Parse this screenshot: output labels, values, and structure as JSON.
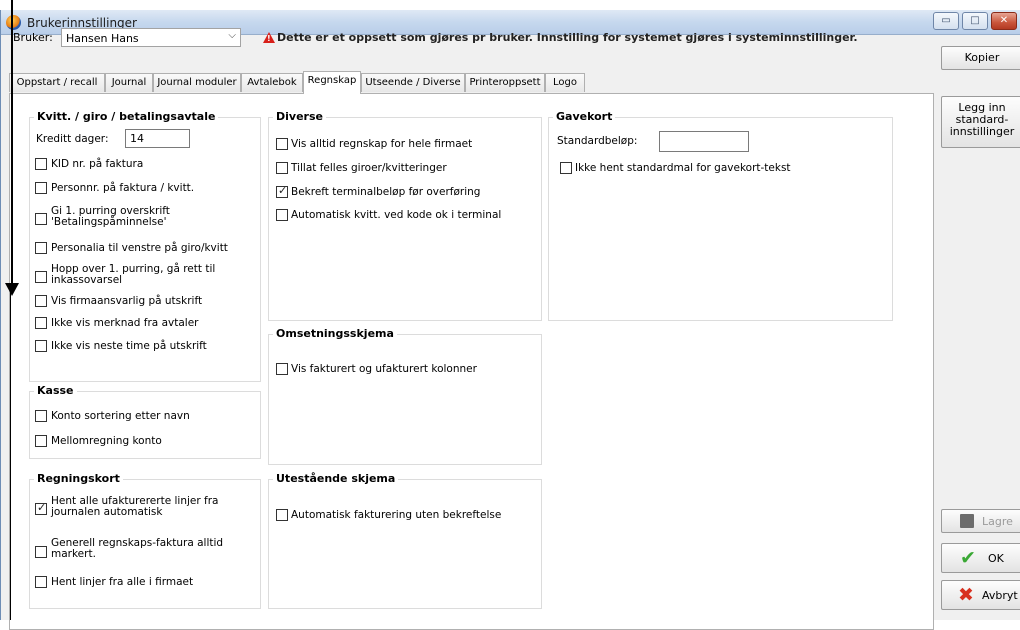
{
  "window": {
    "title": "Brukerinnstillinger",
    "controls": [
      "minimize",
      "maximize",
      "close"
    ]
  },
  "user": {
    "label": "Bruker:",
    "value": "Hansen Hans",
    "warning": "Dette er et oppsett som gjøres pr bruker. Innstilling for systemet gjøres i systeminnstillinger."
  },
  "side_buttons": {
    "copy": "Kopier",
    "standard": "Legg inn standard-innstillinger",
    "save": "Lagre",
    "ok": "OK",
    "cancel": "Avbryt"
  },
  "tabs": [
    "Oppstart / recall",
    "Journal",
    "Journal moduler",
    "Avtalebok",
    "Regnskap",
    "Utseende / Diverse",
    "Printeroppsett",
    "Logo"
  ],
  "active_tab": "Regnskap",
  "kvitt": {
    "title": "Kvitt. / giro / betalingsavtale",
    "kreditt_label": "Kreditt dager:",
    "kreditt_value": "14",
    "items": [
      {
        "label": "KID nr. på faktura",
        "checked": false
      },
      {
        "label": "Personnr. på faktura / kvitt.",
        "checked": false
      },
      {
        "label": "Gi 1. purring overskrift\n'Betalingspåminnelse'",
        "checked": false
      },
      {
        "label": "Personalia til venstre på giro/kvitt",
        "checked": false
      },
      {
        "label": "Hopp over 1. purring, gå rett til\ninkassovarsel",
        "checked": false
      },
      {
        "label": "Vis firmaansvarlig på utskrift",
        "checked": false
      },
      {
        "label": "Ikke vis merknad fra avtaler",
        "checked": false
      },
      {
        "label": "Ikke vis neste time på utskrift",
        "checked": false
      }
    ]
  },
  "kasse": {
    "title": "Kasse",
    "items": [
      {
        "label": "Konto sortering etter navn",
        "checked": false
      },
      {
        "label": "Mellomregning konto",
        "checked": false
      }
    ]
  },
  "regningskort": {
    "title": "Regningskort",
    "items": [
      {
        "label": "Hent alle ufakturererte linjer fra\njournalen automatisk",
        "checked": true
      },
      {
        "label": "Generell regnskaps-faktura alltid\nmarkert.",
        "checked": false
      },
      {
        "label": "Hent linjer fra alle i firmaet",
        "checked": false
      }
    ]
  },
  "diverse": {
    "title": "Diverse",
    "items": [
      {
        "label": "Vis alltid regnskap for hele firmaet",
        "checked": false
      },
      {
        "label": "Tillat felles giroer/kvitteringer",
        "checked": false
      },
      {
        "label": "Bekreft terminalbeløp før overføring",
        "checked": true
      },
      {
        "label": "Automatisk kvitt. ved kode ok i terminal",
        "checked": false
      }
    ]
  },
  "omsetning": {
    "title": "Omsetningsskjema",
    "items": [
      {
        "label": "Vis fakturert og ufakturert kolonner",
        "checked": false
      }
    ]
  },
  "utestaende": {
    "title": "Utestående skjema",
    "title_display": "Utestående skjema",
    "items": [
      {
        "label": "Automatisk fakturering uten bekreftelse",
        "checked": false
      }
    ]
  },
  "gavekort": {
    "title": "Gavekort",
    "standard_label": "Standardbeløp:",
    "standard_value": "",
    "items": [
      {
        "label": "Ikke hent standardmal for gavekort-tekst",
        "checked": false
      }
    ]
  },
  "colors": {
    "titlebar": "#c6d8ee",
    "close": "#c9553b",
    "warning": "#d8201a",
    "ok_green": "#3aa835",
    "cancel_red": "#d8301f"
  }
}
